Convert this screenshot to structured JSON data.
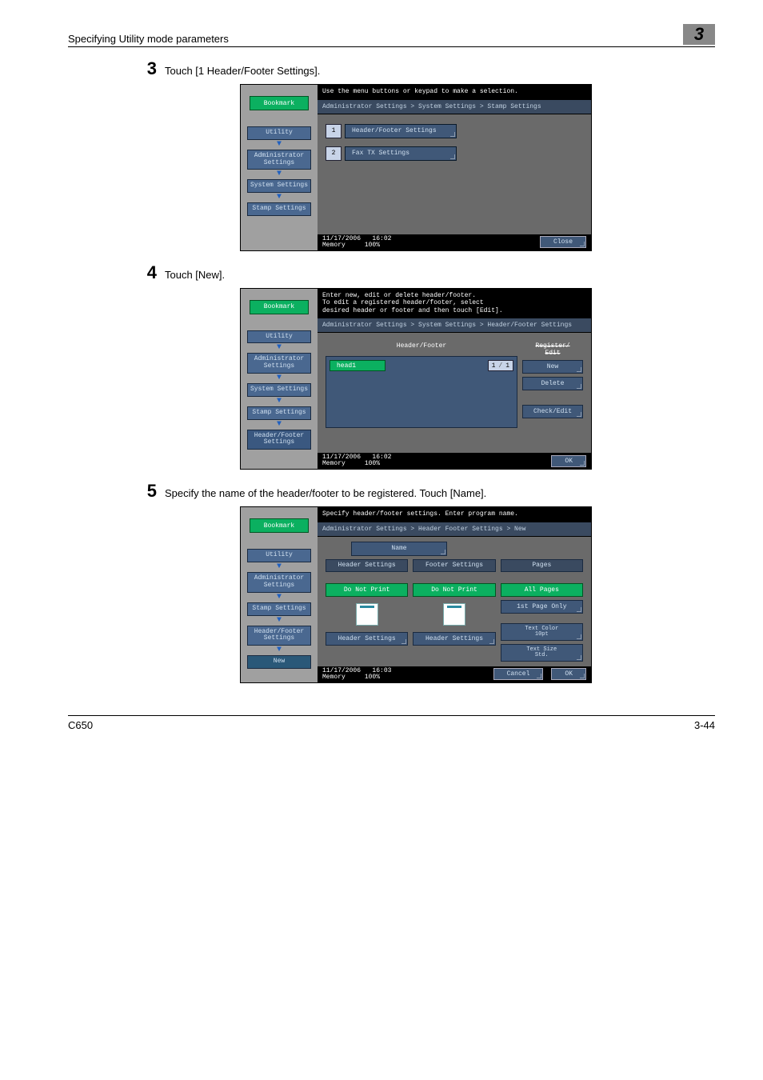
{
  "header": {
    "title": "Specifying Utility mode parameters",
    "chapter": "3"
  },
  "steps": {
    "s3": {
      "num": "3",
      "text": "Touch [1 Header/Footer Settings]."
    },
    "s4": {
      "num": "4",
      "text": "Touch [New]."
    },
    "s5": {
      "num": "5",
      "text": "Specify the name of the header/footer to be registered. Touch [Name]."
    }
  },
  "screen3": {
    "bookmark": "Bookmark",
    "crumbs": [
      "Utility",
      "Administrator\nSettings",
      "System Settings",
      "Stamp Settings"
    ],
    "msg": "Use the menu buttons or keypad to make a selection.",
    "breadcrumb": "Administrator Settings > System Settings > Stamp Settings",
    "items": [
      {
        "num": "1",
        "label": "Header/Footer Settings"
      },
      {
        "num": "2",
        "label": "Fax TX Settings"
      }
    ],
    "status": {
      "date": "11/17/2006",
      "time": "16:02",
      "mem_label": "Memory",
      "mem_val": "100%"
    },
    "close": "Close"
  },
  "screen4": {
    "bookmark": "Bookmark",
    "crumbs": [
      "Utility",
      "Administrator\nSettings",
      "System Settings",
      "Stamp Settings",
      "Header/Footer\nSettings"
    ],
    "msg_l1": "Enter new, edit or delete header/footer.",
    "msg_l2": "To edit a registered header/footer, select",
    "msg_l3": "desired header or footer and then touch [Edit].",
    "breadcrumb": "Administrator Settings > System Settings > Header/Footer Settings",
    "list_title": "Header/Footer",
    "item": "head1",
    "page_cur": "1",
    "page_tot": "1",
    "side_label": "Register/\nEdit",
    "actions": [
      "New",
      "Delete",
      "Check/Edit"
    ],
    "status": {
      "date": "11/17/2006",
      "time": "16:02",
      "mem_label": "Memory",
      "mem_val": "100%"
    },
    "ok": "OK"
  },
  "screen5": {
    "bookmark": "Bookmark",
    "crumbs": [
      "Utility",
      "Administrator\nSettings",
      "Stamp Settings",
      "Header/Footer\nSettings",
      "New"
    ],
    "msg": "Specify header/footer settings. Enter program name.",
    "breadcrumb": "Administrator Settings > Header Footer Settings > New",
    "name_label": "Name",
    "col_heads": [
      "Header Settings",
      "Footer Settings",
      "Pages"
    ],
    "do_not_print": "Do Not Print",
    "header_settings_btn": "Header Settings",
    "pages_opts": [
      "All Pages",
      "1st Page Only"
    ],
    "text_color": {
      "l1": "Text Color",
      "l2": "10pt"
    },
    "text_size": {
      "l1": "Text Size",
      "l2": "Std."
    },
    "status": {
      "date": "11/17/2006",
      "time": "16:03",
      "mem_label": "Memory",
      "mem_val": "100%"
    },
    "cancel": "Cancel",
    "ok": "OK"
  },
  "footer": {
    "left": "C650",
    "right": "3-44"
  }
}
